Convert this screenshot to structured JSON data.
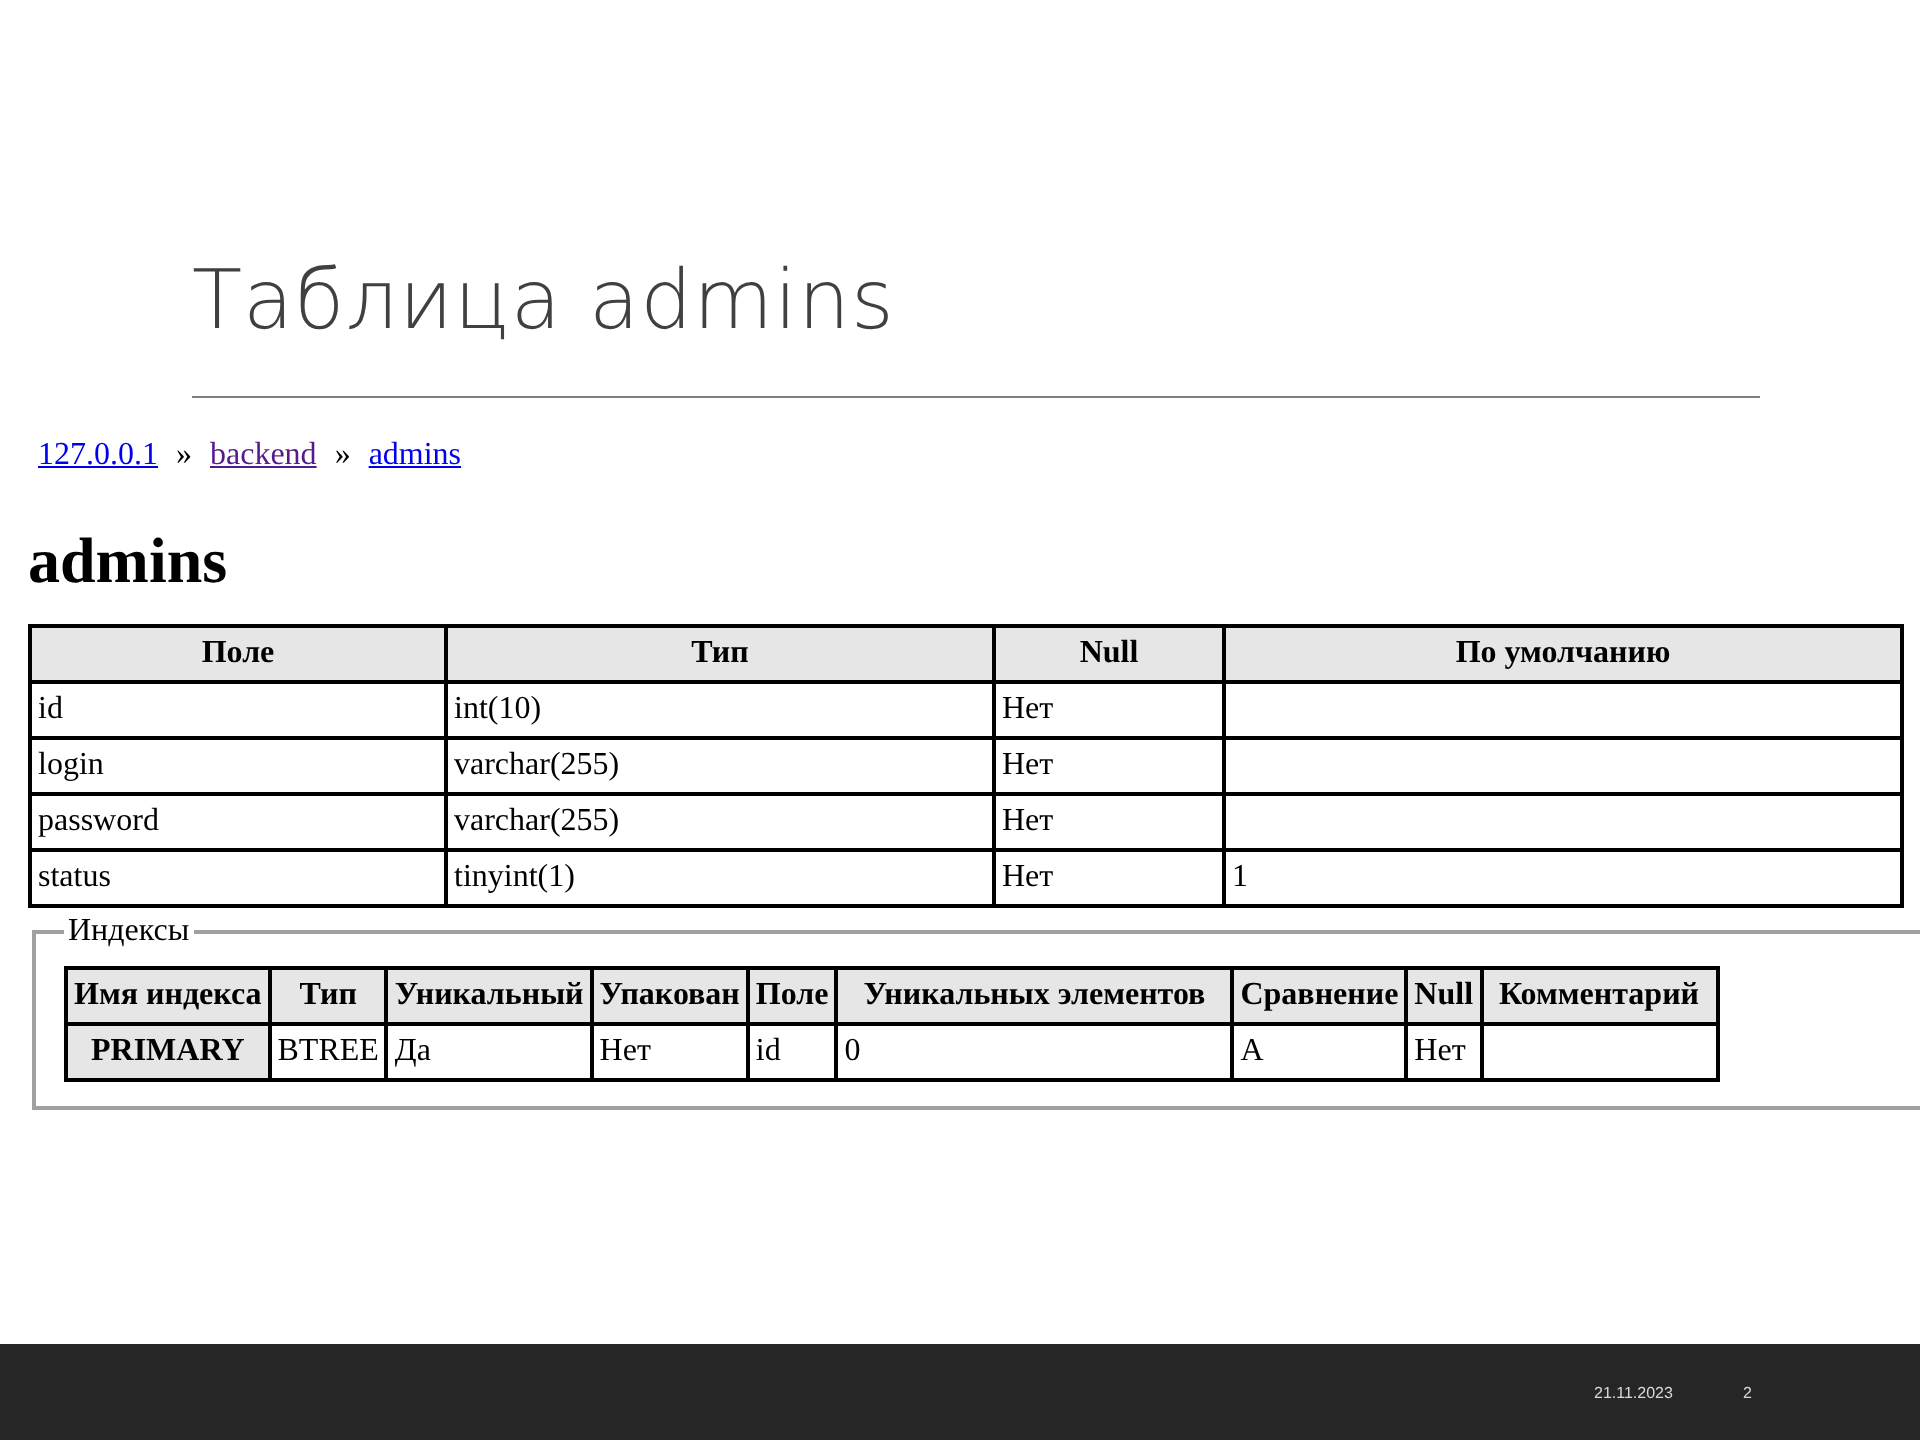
{
  "slide_title": "Таблица admins",
  "breadcrumb": [
    {
      "label": "127.0.0.1",
      "visited": false
    },
    {
      "label": "backend",
      "visited": true
    },
    {
      "label": "admins",
      "visited": false
    }
  ],
  "separator": "»",
  "heading": "admins",
  "table": {
    "columns": [
      "Поле",
      "Тип",
      "Null",
      "По умолчанию"
    ],
    "rows": [
      [
        "id",
        "int(10)",
        "Нет",
        ""
      ],
      [
        "login",
        "varchar(255)",
        "Нет",
        ""
      ],
      [
        "password",
        "varchar(255)",
        "Нет",
        ""
      ],
      [
        "status",
        "tinyint(1)",
        "Нет",
        "1"
      ]
    ]
  },
  "indexes": {
    "legend": "Индексы",
    "columns": [
      "Имя индекса",
      "Тип",
      "Уникальный",
      "Упакован",
      "Поле",
      "Уникальных элементов",
      "Сравнение",
      "Null",
      "Комментарий"
    ],
    "rows": [
      [
        "PRIMARY",
        "BTREE",
        "Да",
        "Нет",
        "id",
        "0",
        "A",
        "Нет",
        ""
      ]
    ]
  },
  "footer": {
    "date": "21.11.2023",
    "page": "2"
  }
}
